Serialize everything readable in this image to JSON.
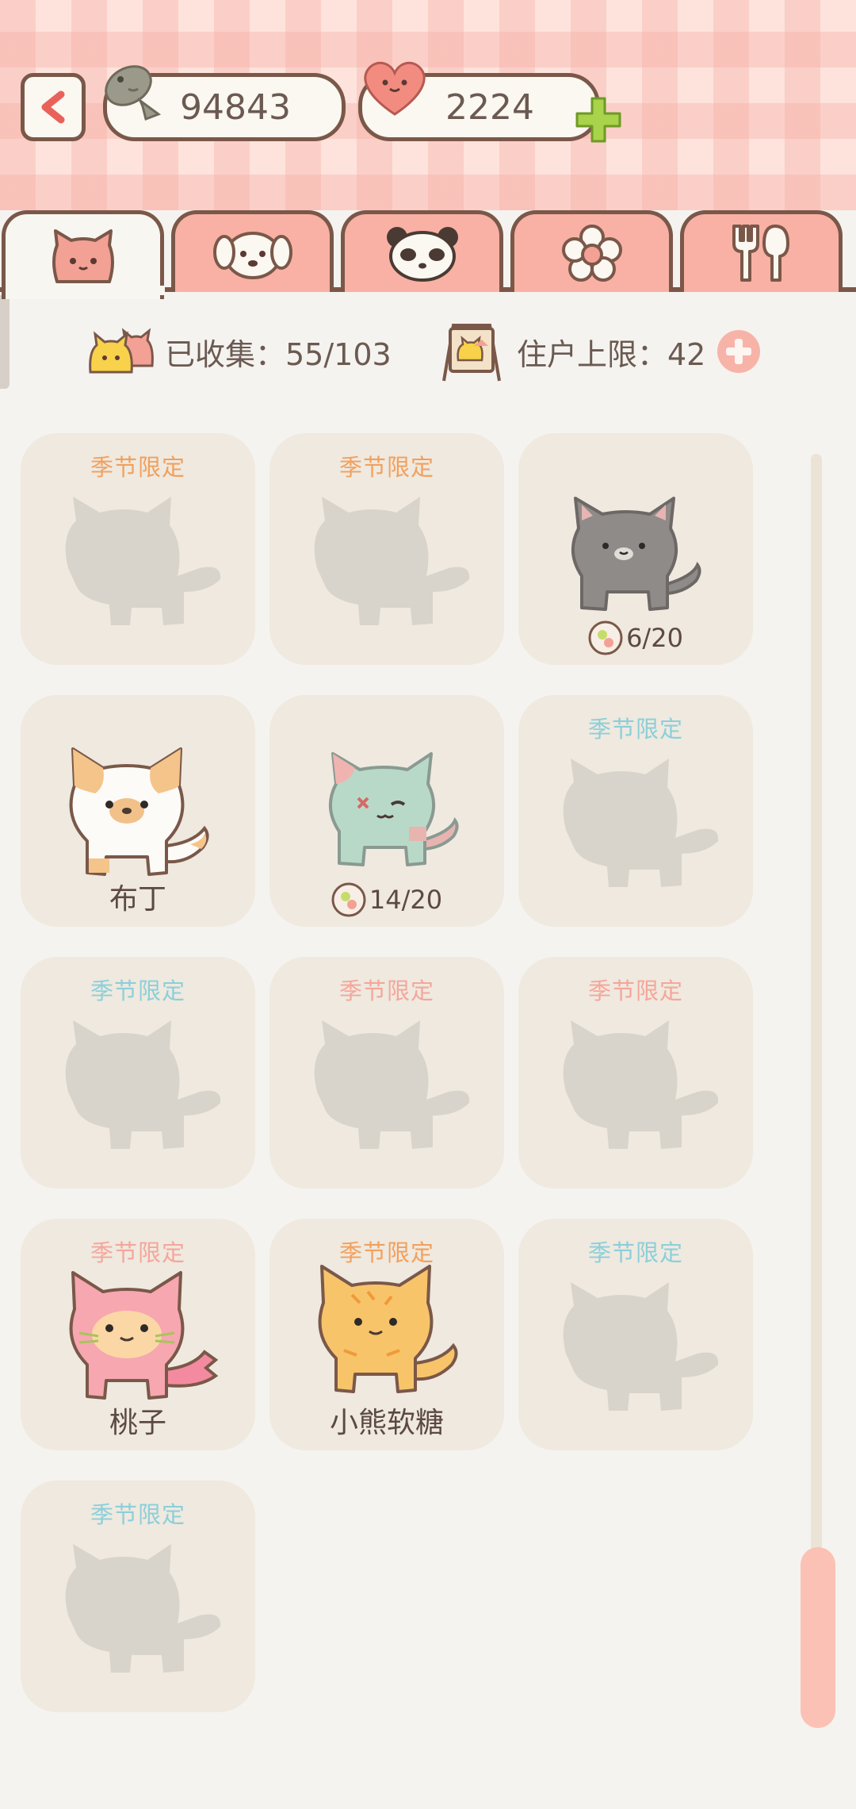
{
  "currency": {
    "fish": "94843",
    "hearts": "2224"
  },
  "tabs": [
    {
      "icon": "cat-face-icon"
    },
    {
      "icon": "dog-face-icon"
    },
    {
      "icon": "panda-face-icon"
    },
    {
      "icon": "flower-icon"
    },
    {
      "icon": "fork-spoon-icon"
    }
  ],
  "info": {
    "collected_label": "已收集：55/103",
    "residents_label": "住户上限：42"
  },
  "cards": [
    {
      "tag": "季节限定",
      "tag_color": "#f2a05d",
      "state": "locked"
    },
    {
      "tag": "季节限定",
      "tag_color": "#f2a05d",
      "state": "locked"
    },
    {
      "tag": "",
      "state": "progress",
      "progress": "6/20",
      "cat": "gray"
    },
    {
      "tag": "",
      "state": "owned",
      "name": "布丁",
      "cat": "calico"
    },
    {
      "tag": "",
      "state": "progress",
      "progress": "14/20",
      "cat": "zombie"
    },
    {
      "tag": "季节限定",
      "tag_color": "#8ccfd9",
      "state": "locked"
    },
    {
      "tag": "季节限定",
      "tag_color": "#8ccfd9",
      "state": "locked"
    },
    {
      "tag": "季节限定",
      "tag_color": "#f5a69b",
      "state": "locked"
    },
    {
      "tag": "季节限定",
      "tag_color": "#f5a69b",
      "state": "locked"
    },
    {
      "tag": "季节限定",
      "tag_color": "#f5a69b",
      "state": "owned",
      "name": "桃子",
      "cat": "peach"
    },
    {
      "tag": "季节限定",
      "tag_color": "#f2a05d",
      "state": "owned",
      "name": "小熊软糖",
      "cat": "gummy"
    },
    {
      "tag": "季节限定",
      "tag_color": "#8ccfd9",
      "state": "locked"
    },
    {
      "tag": "季节限定",
      "tag_color": "#8ccfd9",
      "state": "locked"
    }
  ]
}
